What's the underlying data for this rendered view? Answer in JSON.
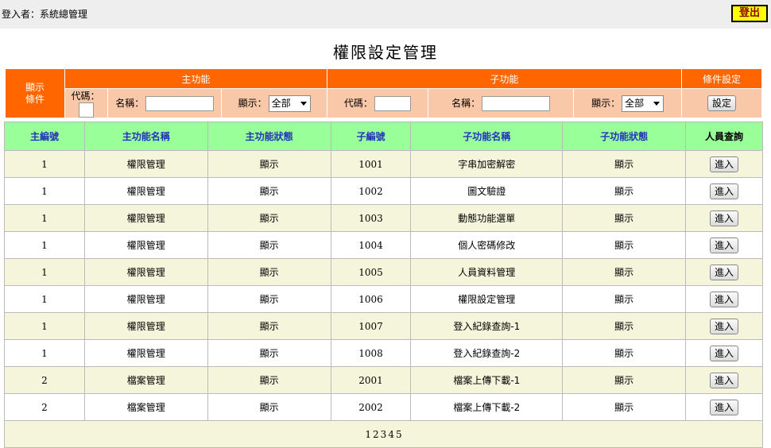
{
  "header": {
    "login_label": "登入者：系統總管理",
    "logout_label": "登出"
  },
  "page_title": "權限設定管理",
  "filter": {
    "side_label_line1": "顯示",
    "side_label_line2": "條件",
    "main_group": "主功能",
    "sub_group": "子功能",
    "condition_group": "條件設定",
    "code_label": "代碼：",
    "name_label": "名稱：",
    "show_label": "顯示：",
    "main_code_value": "",
    "main_name_value": "",
    "main_show_selected": "全部",
    "sub_code_value": "",
    "sub_name_value": "",
    "sub_show_selected": "全部",
    "set_button": "設定"
  },
  "table": {
    "headers": [
      "主編號",
      "主功能名稱",
      "主功能狀態",
      "子編號",
      "子功能名稱",
      "子功能狀態",
      "人員查詢"
    ],
    "enter_label": "進入",
    "rows": [
      {
        "main_id": "1",
        "main_name": "權限管理",
        "main_status": "顯示",
        "sub_id": "1001",
        "sub_name": "字串加密解密",
        "sub_status": "顯示"
      },
      {
        "main_id": "1",
        "main_name": "權限管理",
        "main_status": "顯示",
        "sub_id": "1002",
        "sub_name": "圖文驗證",
        "sub_status": "顯示"
      },
      {
        "main_id": "1",
        "main_name": "權限管理",
        "main_status": "顯示",
        "sub_id": "1003",
        "sub_name": "動態功能選單",
        "sub_status": "顯示"
      },
      {
        "main_id": "1",
        "main_name": "權限管理",
        "main_status": "顯示",
        "sub_id": "1004",
        "sub_name": "個人密碼修改",
        "sub_status": "顯示"
      },
      {
        "main_id": "1",
        "main_name": "權限管理",
        "main_status": "顯示",
        "sub_id": "1005",
        "sub_name": "人員資料管理",
        "sub_status": "顯示"
      },
      {
        "main_id": "1",
        "main_name": "權限管理",
        "main_status": "顯示",
        "sub_id": "1006",
        "sub_name": "權限設定管理",
        "sub_status": "顯示"
      },
      {
        "main_id": "1",
        "main_name": "權限管理",
        "main_status": "顯示",
        "sub_id": "1007",
        "sub_name": "登入紀錄查詢-1",
        "sub_status": "顯示"
      },
      {
        "main_id": "1",
        "main_name": "權限管理",
        "main_status": "顯示",
        "sub_id": "1008",
        "sub_name": "登入紀錄查詢-2",
        "sub_status": "顯示"
      },
      {
        "main_id": "2",
        "main_name": "檔案管理",
        "main_status": "顯示",
        "sub_id": "2001",
        "sub_name": "檔案上傳下載-1",
        "sub_status": "顯示"
      },
      {
        "main_id": "2",
        "main_name": "檔案管理",
        "main_status": "顯示",
        "sub_id": "2002",
        "sub_name": "檔案上傳下載-2",
        "sub_status": "顯示"
      }
    ]
  },
  "pager": {
    "pages": [
      "1",
      "2",
      "3",
      "4",
      "5"
    ]
  }
}
